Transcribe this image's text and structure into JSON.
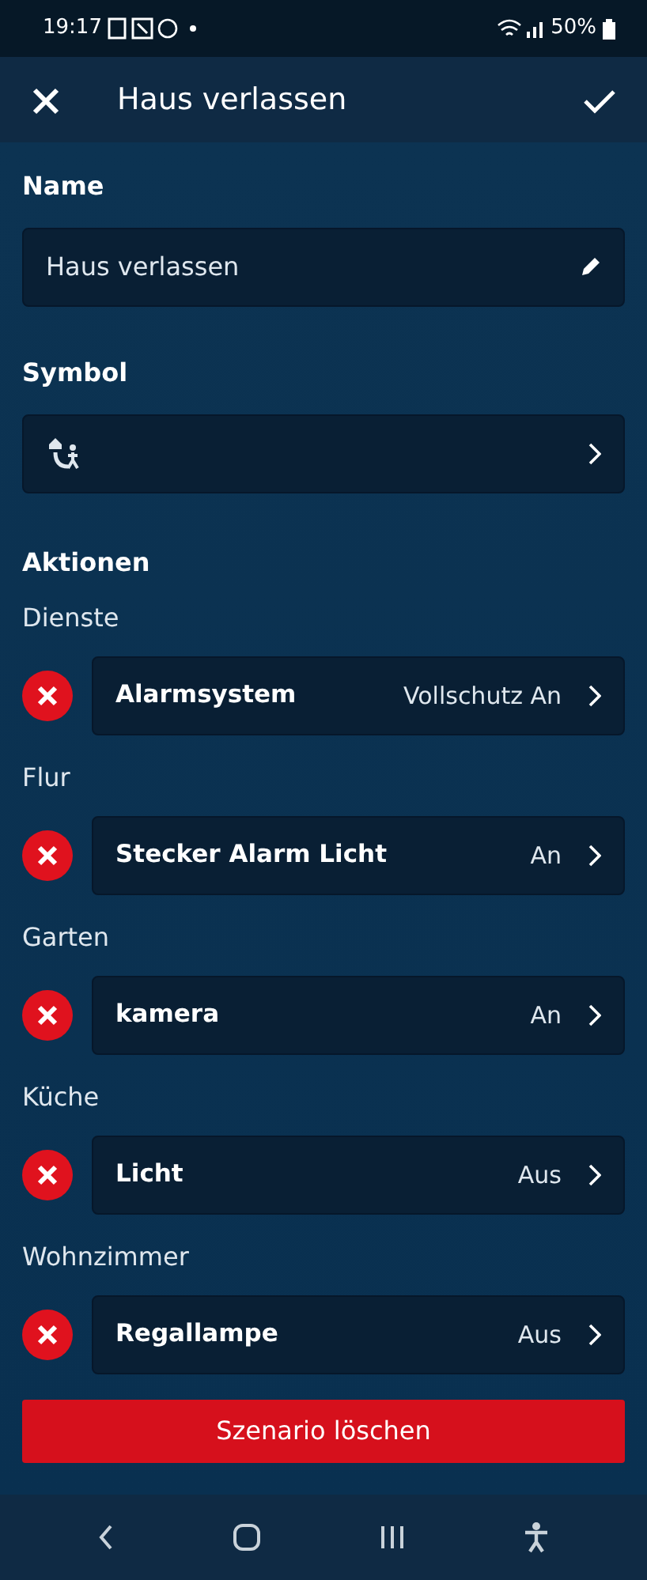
{
  "status_bar": {
    "time": "19:17",
    "battery": "50%"
  },
  "header": {
    "title": "Haus verlassen"
  },
  "name_section": {
    "label": "Name",
    "value": "Haus verlassen"
  },
  "symbol_section": {
    "label": "Symbol"
  },
  "actions": {
    "label": "Aktionen",
    "groups": [
      {
        "room": "Dienste",
        "device": "Alarmsystem",
        "state": "Vollschutz An"
      },
      {
        "room": "Flur",
        "device": "Stecker Alarm Licht",
        "state": "An"
      },
      {
        "room": "Garten",
        "device": "kamera",
        "state": "An"
      },
      {
        "room": "Küche",
        "device": "Licht",
        "state": "Aus"
      },
      {
        "room": "Wohnzimmer",
        "device": "Regallampe",
        "state": "Aus"
      }
    ]
  },
  "delete_button": "Szenario löschen"
}
